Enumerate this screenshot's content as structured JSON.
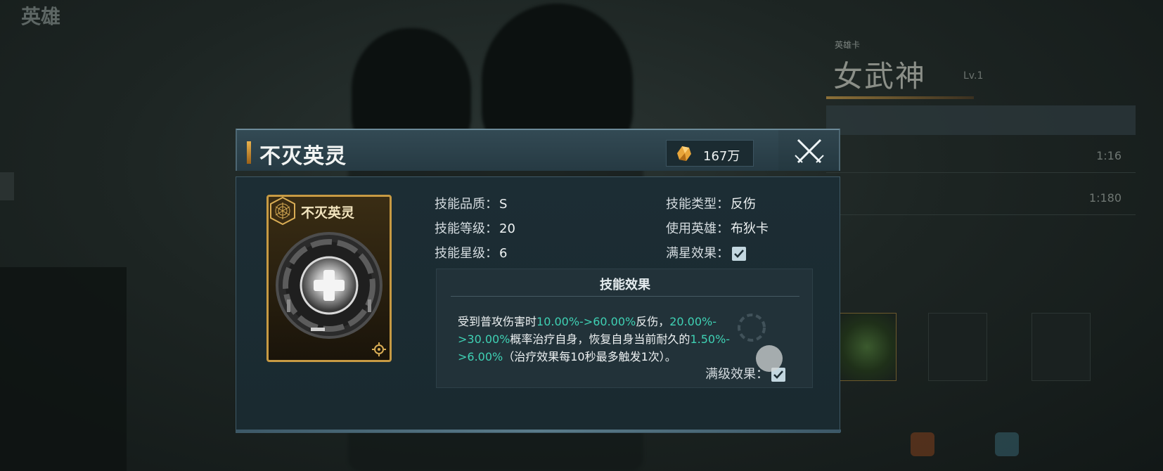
{
  "background": {
    "title": "英雄",
    "hero_subtitle": "英雄卡",
    "hero_name": "女武神",
    "hero_level": "Lv.1",
    "row1_value": "1:16",
    "row2_value": "1:180",
    "slot_labels": [
      "",
      "",
      ""
    ]
  },
  "dialog": {
    "title": "不灭英灵",
    "currency": {
      "icon": "gold-crystal-icon",
      "value": "167万"
    },
    "close_icon": "crossed-swords-close-icon",
    "card": {
      "name": "不灭英灵",
      "art_icon": "heal-cross-orb-icon"
    },
    "stats": {
      "quality_label": "技能品质：",
      "quality_value": "S",
      "level_label": "技能等级：",
      "level_value": "20",
      "star_label": "技能星级：",
      "star_value": "6",
      "type_label": "技能类型：",
      "type_value": "反伤",
      "hero_label": "使用英雄：",
      "hero_value": "布狄卡",
      "fullstar_label": "满星效果：",
      "fullstar_checked": true
    },
    "effect": {
      "title": "技能效果",
      "t1": "受到普攻伤害时",
      "h1": "10.00%->60.00%",
      "t2": "反伤，",
      "h2": "20.00%->30.00%",
      "t3": "概率治疗自身，恢复自身当前耐久的",
      "h3": "1.50%->6.00%",
      "t4": "（治疗效果每10秒最多触发1次）。",
      "full_level_label": "满级效果：",
      "full_level_checked": true
    }
  },
  "colors": {
    "accent_gold": "#c79a43",
    "highlight_teal": "#3fd1b4",
    "panel_bg": "#1c2d34"
  }
}
